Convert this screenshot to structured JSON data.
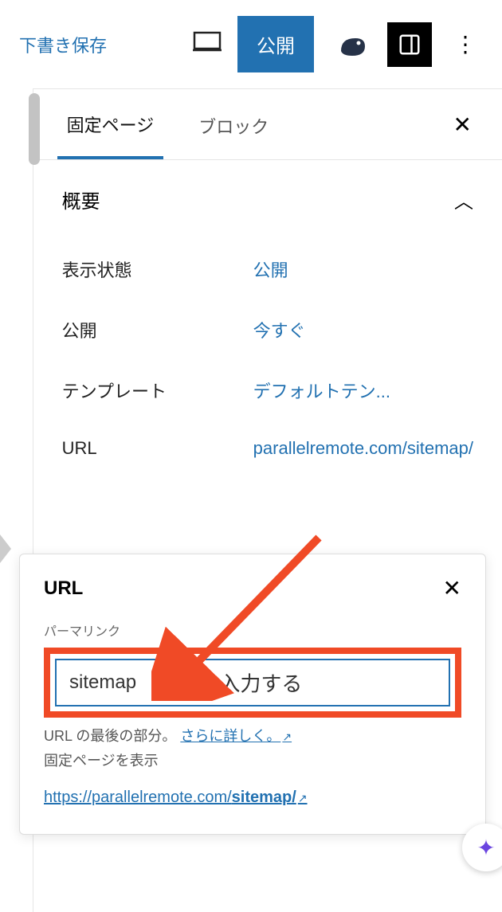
{
  "toolbar": {
    "draft_save": "下書き保存",
    "publish": "公開"
  },
  "tabs": {
    "page": "固定ページ",
    "block": "ブロック"
  },
  "section": {
    "summary": "概要"
  },
  "summary": {
    "visibility_label": "表示状態",
    "visibility_value": "公開",
    "publish_label": "公開",
    "publish_value": "今すぐ",
    "template_label": "テンプレート",
    "template_value": "デフォルトテン...",
    "url_label": "URL",
    "url_value": "parallelremote.com/sitemap/"
  },
  "popover": {
    "title": "URL",
    "field_label": "パーマリンク",
    "input_value": "sitemap",
    "annotation": "入力する",
    "help_prefix": "URL の最後の部分。 ",
    "help_link": "さらに詳しく。",
    "view_label": "固定ページを表示",
    "view_url_prefix": "https://parallelremote.com/",
    "view_url_bold": "sitemap/"
  }
}
